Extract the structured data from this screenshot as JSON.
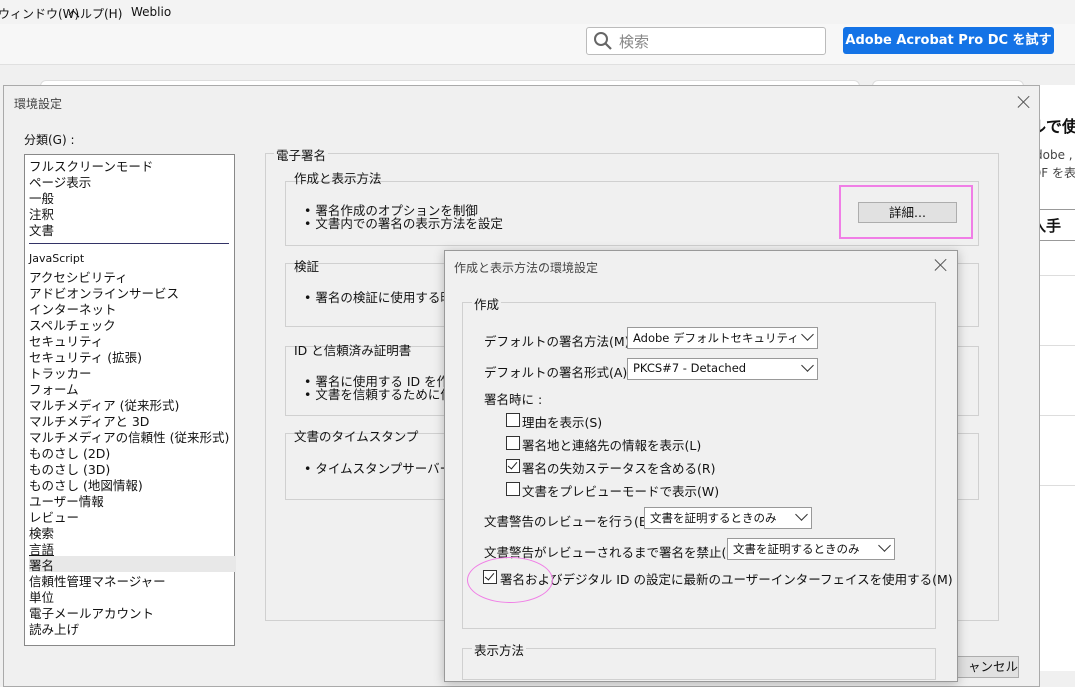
{
  "menubar": {
    "items": [
      "ウィンドウ(W)",
      "ヘルプ(H)",
      "Weblio"
    ]
  },
  "toolbar": {
    "search_placeholder": "検索",
    "try_button": "Adobe Acrobat Pro DC を試す"
  },
  "right_pane": {
    "heading": "ルで使",
    "line1": "dobe ,",
    "line2": "DF を表",
    "button": "入手"
  },
  "prefs": {
    "title": "環境設定",
    "category_label": "分類(G) :",
    "categories_top": [
      "フルスクリーンモード",
      "ページ表示",
      "一般",
      "注釈",
      "文書"
    ],
    "categories_bottom": [
      "JavaScript",
      "アクセシビリティ",
      "アドビオンラインサービス",
      "インターネット",
      "スペルチェック",
      "セキュリティ",
      "セキュリティ (拡張)",
      "トラッカー",
      "フォーム",
      "マルチメディア (従来形式)",
      "マルチメディアと 3D",
      "マルチメディアの信頼性 (従来形式)",
      "ものさし (2D)",
      "ものさし (3D)",
      "ものさし (地図情報)",
      "ユーザー情報",
      "レビュー",
      "検索",
      "言語",
      "署名",
      "信頼性管理マネージャー",
      "単位",
      "電子メールアカウント",
      "読み上げ"
    ],
    "selected": "署名",
    "section_title": "電子署名",
    "create": {
      "title": "作成と表示方法",
      "line1": "• 署名作成のオプションを制御",
      "line2": "• 文書内での署名の表示方法を設定",
      "details_button": "詳細..."
    },
    "verify": {
      "title": "検証",
      "line1": "• 署名の検証に使用する時"
    },
    "identity": {
      "title": "ID と信頼済み証明書",
      "line1": "• 署名に使用する ID を作成",
      "line2": "• 文書を信頼するために使用"
    },
    "timestamp": {
      "title": "文書のタイムスタンプ",
      "line1": "• タイムスタンプサーバーを設"
    },
    "cancel_button": "ャンセル"
  },
  "sub": {
    "title": "作成と表示方法の環境設定",
    "group_create": "作成",
    "method_label": "デフォルトの署名方法(M) :",
    "method_value": "Adobe デフォルトセキュリティ",
    "format_label": "デフォルトの署名形式(A) :",
    "format_value": "PKCS#7 - Detached",
    "when_signing": "署名時に :",
    "checks": [
      {
        "label": "理由を表示(S)",
        "checked": false
      },
      {
        "label": "署名地と連絡先の情報を表示(L)",
        "checked": false
      },
      {
        "label": "署名の失効ステータスを含める(R)",
        "checked": true
      },
      {
        "label": "文書をプレビューモードで表示(W)",
        "checked": false
      }
    ],
    "review_label": "文書警告のレビューを行う(E) :",
    "review_value": "文書を証明するときのみ",
    "prevent_label": "文書警告がレビューされるまで署名を禁止(P) :",
    "prevent_value": "文書を証明するときのみ",
    "modern_ui": {
      "label": "署名およびデジタル ID の設定に最新のユーザーインターフェイスを使用する(M)",
      "checked": true
    },
    "group_display": "表示方法"
  },
  "colors": {
    "accent": "#1473e6",
    "highlight": "#f07ee6"
  }
}
